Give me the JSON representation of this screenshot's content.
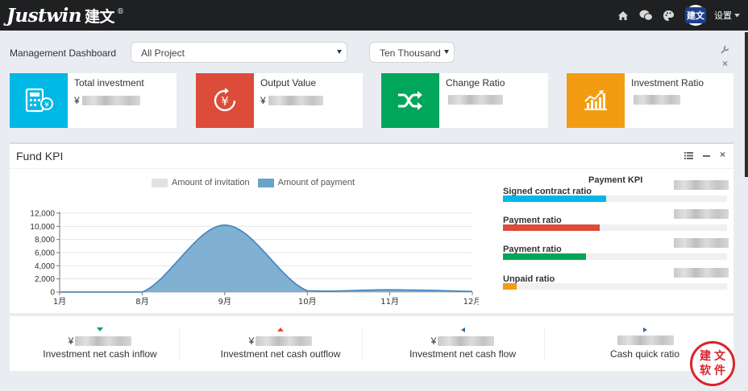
{
  "header": {
    "brand": "Justwin",
    "brand_cn": "建文",
    "brand_reg": "®",
    "avatar_text": "建文",
    "settings_label": "设置",
    "icons": [
      "home-icon",
      "wechat-icon",
      "skin-icon",
      "avatar"
    ]
  },
  "filters": {
    "dashboard_label": "Management Dashboard",
    "project_select": "All Project",
    "unit_select": "Ten Thousand"
  },
  "stat_cards": [
    {
      "title": "Total investment",
      "currency": "¥",
      "color": "#00b8e6",
      "icon": "calculator-icon"
    },
    {
      "title": "Output Value",
      "currency": "¥",
      "color": "#dd4b39",
      "icon": "yen-refresh-icon"
    },
    {
      "title": "Change Ratio",
      "currency": "",
      "color": "#00a65a",
      "icon": "shuffle-icon"
    },
    {
      "title": "Investment Ratio",
      "currency": "",
      "color": "#f39c12",
      "icon": "growth-chart-icon"
    }
  ],
  "fund_kpi": {
    "title": "Fund KPI",
    "legend": [
      {
        "name": "Amount of invitation",
        "color": "#dfe3e7"
      },
      {
        "name": "Amount of payment",
        "color": "#6aa2ca"
      }
    ]
  },
  "chart_data": {
    "type": "area",
    "x": [
      "1月",
      "8月",
      "9月",
      "10月",
      "11月",
      "12月"
    ],
    "series": [
      {
        "name": "Amount of invitation",
        "values": [
          0,
          0,
          0,
          0,
          0,
          0
        ]
      },
      {
        "name": "Amount of payment",
        "values": [
          0,
          0,
          10200,
          200,
          350,
          100
        ]
      }
    ],
    "yticks": [
      "0",
      "2,000",
      "4,000",
      "6,000",
      "8,000",
      "10,000",
      "12,000"
    ],
    "ylim": [
      0,
      12000
    ],
    "grid": true,
    "legend_position": "top"
  },
  "payment_kpi": {
    "title": "Payment KPI",
    "rows": [
      {
        "label": "Signed contract ratio",
        "color": "#00b8e6",
        "ratio": 0.46
      },
      {
        "label": "Payment ratio",
        "color": "#dd4b39",
        "ratio": 0.43
      },
      {
        "label": "Payment ratio",
        "color": "#00a65a",
        "ratio": 0.37
      },
      {
        "label": "Unpaid ratio",
        "color": "#f39c12",
        "ratio": 0.06
      }
    ]
  },
  "metrics": [
    {
      "label": "Investment net cash inflow",
      "currency": "¥",
      "arrow": "down",
      "arrow_color": "#00a65a"
    },
    {
      "label": "Investment net cash outflow",
      "currency": "¥",
      "arrow": "up",
      "arrow_color": "#dd4b39"
    },
    {
      "label": "Investment net cash flow",
      "currency": "¥",
      "arrow": "left",
      "arrow_color": "#2b6cb0"
    },
    {
      "label": "Cash quick ratio",
      "currency": "",
      "arrow": "right",
      "arrow_color": "#2b6cb0"
    }
  ],
  "seal_chars": [
    "建",
    "文",
    "软",
    "件"
  ]
}
